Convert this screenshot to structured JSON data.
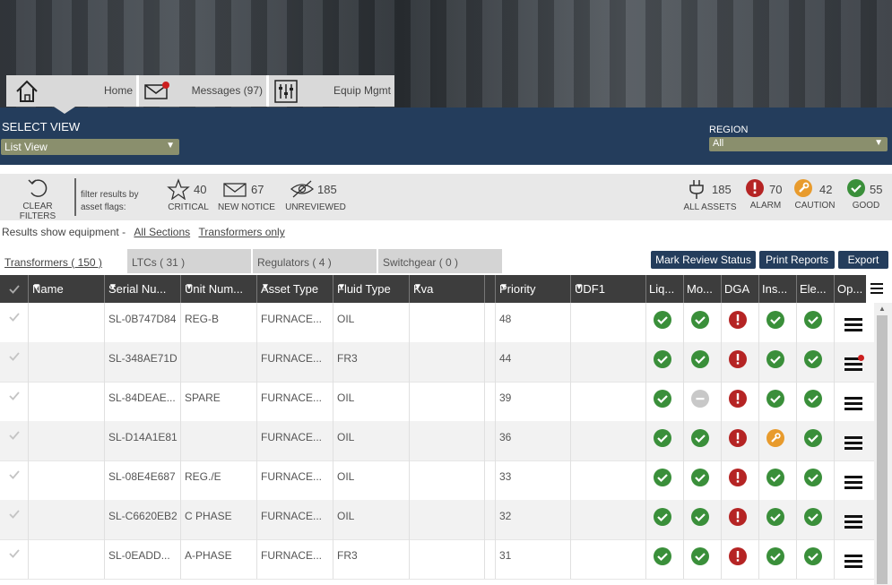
{
  "nav": {
    "tabs": [
      {
        "label": "Home",
        "icon": "home-icon"
      },
      {
        "label": "Messages (97)",
        "icon": "envelope-icon"
      },
      {
        "label": "Equip Mgmt",
        "icon": "sliders-icon"
      }
    ]
  },
  "banner": {
    "select_view_label": "SELECT VIEW",
    "select_view_value": "List View",
    "region_label": "REGION",
    "region_value": "All"
  },
  "filters": {
    "clear_label": "CLEAR FILTERS",
    "filter_text": "filter results by asset flags:",
    "flags": [
      {
        "count": "40",
        "label": "CRITICAL",
        "icon": "star-icon"
      },
      {
        "count": "67",
        "label": "NEW NOTICE",
        "icon": "envelope-icon"
      },
      {
        "count": "185",
        "label": "UNREVIEWED",
        "icon": "eye-slash-icon"
      }
    ],
    "status": [
      {
        "count": "185",
        "label": "ALL ASSETS",
        "icon": "plug-icon"
      },
      {
        "count": "70",
        "label": "ALARM",
        "icon": "alarm-icon",
        "color": "#b52424"
      },
      {
        "count": "42",
        "label": "CAUTION",
        "icon": "wrench-icon",
        "color": "#e89b2d"
      },
      {
        "count": "55",
        "label": "GOOD",
        "icon": "check-icon",
        "color": "#3a8f3a"
      }
    ]
  },
  "results": {
    "prefix": "Results show equipment -",
    "all_sections": "All Sections",
    "transformers_only": "Transformers only"
  },
  "equipment_tabs": [
    {
      "label": "Transformers ( 150 )"
    },
    {
      "label": "LTCs ( 31 )"
    },
    {
      "label": "Regulators ( 4 )"
    },
    {
      "label": "Switchgear ( 0 )"
    }
  ],
  "actions": {
    "mark_review": "Mark Review Status",
    "print_reports": "Print Reports",
    "export": "Export"
  },
  "columns": {
    "name": "Name",
    "serial": "Serial Nu...",
    "unit": "Unit Num...",
    "asset_type": "Asset Type",
    "fluid_type": "Fluid Type",
    "kva": "Kva",
    "priority": "Priority",
    "udf1": "UDF1",
    "liq": "Liq...",
    "mo": "Mo...",
    "dga": "DGA",
    "ins": "Ins...",
    "ele": "Ele...",
    "op": "Op..."
  },
  "rows": [
    {
      "name": "",
      "serial": "SL-0B747D84",
      "unit": "REG-B",
      "asset_type": "FURNACE...",
      "fluid": "OIL",
      "kva": "",
      "priority": "48",
      "udf1": "",
      "status": [
        "good",
        "good",
        "alarm",
        "good",
        "good"
      ],
      "menu_dot": false
    },
    {
      "name": "",
      "serial": "SL-348AE71D",
      "unit": "",
      "asset_type": "FURNACE...",
      "fluid": "FR3",
      "kva": "",
      "priority": "44",
      "udf1": "",
      "status": [
        "good",
        "good",
        "alarm",
        "good",
        "good"
      ],
      "menu_dot": true
    },
    {
      "name": "",
      "serial": "SL-84DEAE...",
      "unit": "SPARE",
      "asset_type": "FURNACE...",
      "fluid": "OIL",
      "kva": "",
      "priority": "39",
      "udf1": "",
      "status": [
        "good",
        "none",
        "alarm",
        "good",
        "good"
      ],
      "menu_dot": false
    },
    {
      "name": "",
      "serial": "SL-D14A1E81",
      "unit": "",
      "asset_type": "FURNACE...",
      "fluid": "OIL",
      "kva": "",
      "priority": "36",
      "udf1": "",
      "status": [
        "good",
        "good",
        "alarm",
        "caution",
        "good"
      ],
      "menu_dot": false
    },
    {
      "name": "",
      "serial": "SL-08E4E687",
      "unit": "REG./E",
      "asset_type": "FURNACE...",
      "fluid": "OIL",
      "kva": "",
      "priority": "33",
      "udf1": "",
      "status": [
        "good",
        "good",
        "alarm",
        "good",
        "good"
      ],
      "menu_dot": false
    },
    {
      "name": "",
      "serial": "SL-C6620EB2",
      "unit": "C PHASE",
      "asset_type": "FURNACE...",
      "fluid": "OIL",
      "kva": "",
      "priority": "32",
      "udf1": "",
      "status": [
        "good",
        "good",
        "alarm",
        "good",
        "good"
      ],
      "menu_dot": false
    },
    {
      "name": "",
      "serial": "SL-0EADD...",
      "unit": "A-PHASE",
      "asset_type": "FURNACE...",
      "fluid": "FR3",
      "kva": "",
      "priority": "31",
      "udf1": "",
      "status": [
        "good",
        "good",
        "alarm",
        "good",
        "good"
      ],
      "menu_dot": false
    }
  ]
}
